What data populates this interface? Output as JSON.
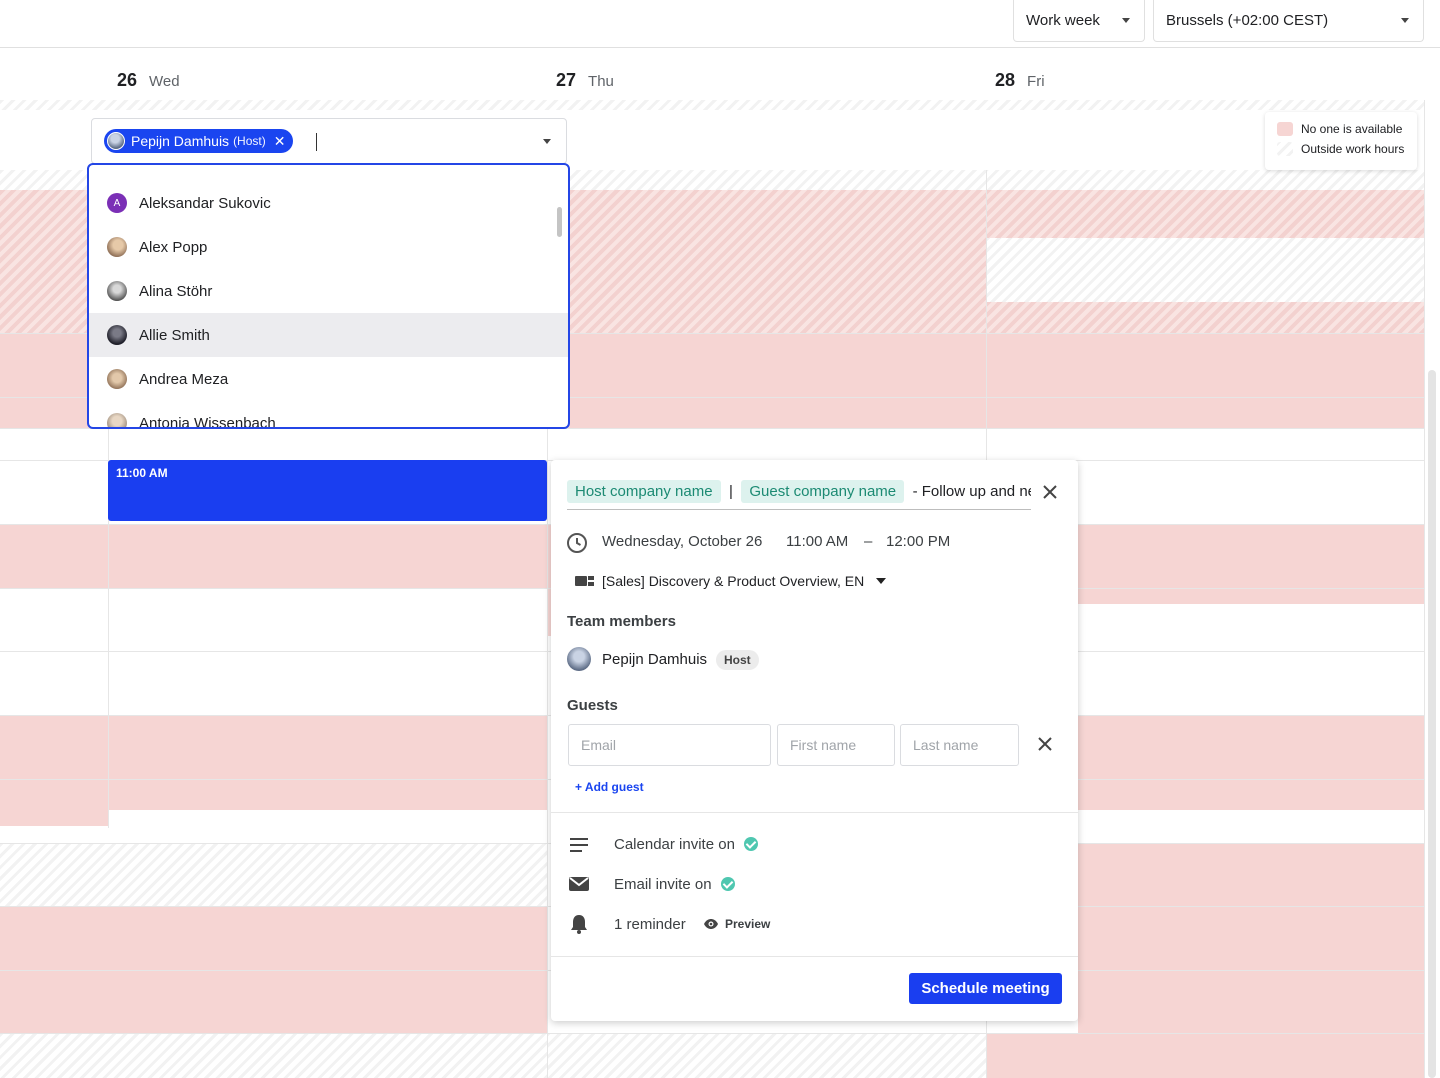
{
  "toolbar": {
    "view_select": "Work week",
    "timezone_select": "Brussels (+02:00 CEST)"
  },
  "days": [
    {
      "num": "26",
      "name": "Wed"
    },
    {
      "num": "27",
      "name": "Thu"
    },
    {
      "num": "28",
      "name": "Fri"
    }
  ],
  "attendee_picker": {
    "chip_name": "Pepijn Damhuis",
    "chip_role": "(Host)",
    "options": [
      {
        "name": "Aleksandar Sukovic",
        "initial": "A",
        "avatar_color": "#7b2fb6"
      },
      {
        "name": "Alex Popp",
        "avatar_color": "#b08b6e"
      },
      {
        "name": "Alina Stöhr",
        "avatar_color": "#6e6e6e"
      },
      {
        "name": "Allie Smith",
        "avatar_color": "#2d2d3a",
        "highlighted": true
      },
      {
        "name": "Andrea Meza",
        "avatar_color": "#b89a7c"
      },
      {
        "name": "Antonia Wissenbach",
        "avatar_color": "#9a8a7a"
      }
    ]
  },
  "legend": {
    "unavailable": "No one is available",
    "outside_hours": "Outside work hours",
    "unavailable_color": "#f6d5d3"
  },
  "event": {
    "time": "11:00 AM",
    "color": "#1a3ef0"
  },
  "meeting": {
    "title_host_tag": "Host company name",
    "title_separator": "|",
    "title_guest_tag": "Guest company name",
    "title_rest": "- Follow up and next",
    "date": "Wednesday, October 26",
    "start": "11:00 AM",
    "dash": "–",
    "end": "12:00 PM",
    "meeting_type": "[Sales] Discovery & Product Overview, EN",
    "team_heading": "Team members",
    "team_member": "Pepijn Damhuis",
    "team_member_badge": "Host",
    "guests_heading": "Guests",
    "email_placeholder": "Email",
    "first_name_placeholder": "First name",
    "last_name_placeholder": "Last name",
    "add_guest": "+ Add guest",
    "calendar_invite": "Calendar invite on",
    "email_invite": "Email invite on",
    "reminder": "1 reminder",
    "preview": "Preview",
    "schedule_button": "Schedule meeting"
  }
}
